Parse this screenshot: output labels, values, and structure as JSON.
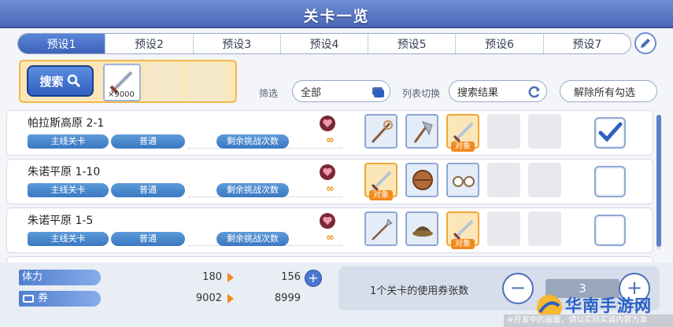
{
  "header": {
    "title": "关卡一览"
  },
  "tabs": [
    "预设1",
    "预设2",
    "预设3",
    "预设4",
    "预设5",
    "预设6",
    "预设7"
  ],
  "active_tab": "预设1",
  "search": {
    "button_label": "搜索",
    "item_count": "×9000"
  },
  "filter": {
    "label": "筛选",
    "value": "全部"
  },
  "list_switch": {
    "label": "列表切换",
    "value": "搜索结果"
  },
  "clear_button": "解除所有勾选",
  "quests": [
    {
      "name": "帕拉斯高原 2-1",
      "type": "主线关卡",
      "difficulty": "普通",
      "remaining_label": "剩余挑战次数",
      "remaining": "∞",
      "items": [
        "staff",
        "axe",
        "sword"
      ],
      "target_index": 2,
      "checked": true
    },
    {
      "name": "朱诺平原 1-10",
      "type": "主线关卡",
      "difficulty": "普通",
      "remaining_label": "剩余挑战次数",
      "remaining": "∞",
      "items": [
        "sword",
        "shield",
        "glasses"
      ],
      "target_index": 0,
      "checked": false
    },
    {
      "name": "朱诺平原 1-5",
      "type": "主线关卡",
      "difficulty": "普通",
      "remaining_label": "剩余挑战次数",
      "remaining": "∞",
      "items": [
        "spear",
        "hat",
        "sword"
      ],
      "target_index": 2,
      "checked": false
    }
  ],
  "target_tag": "对象",
  "stats": {
    "stamina": {
      "label": "体力",
      "from": "180",
      "to": "156"
    },
    "ticket": {
      "label": "券",
      "from": "9002",
      "to": "8999"
    }
  },
  "ticket_usage": {
    "label": "1个关卡的使用券张数",
    "value": "3"
  },
  "watermark": {
    "brand": "华南手游网",
    "footer": "※开发中的画面，请以实际实装内容为准"
  },
  "colors": {
    "accent": "#3c63b8",
    "target": "#f08a1c",
    "watermark": "#2a60c8"
  }
}
